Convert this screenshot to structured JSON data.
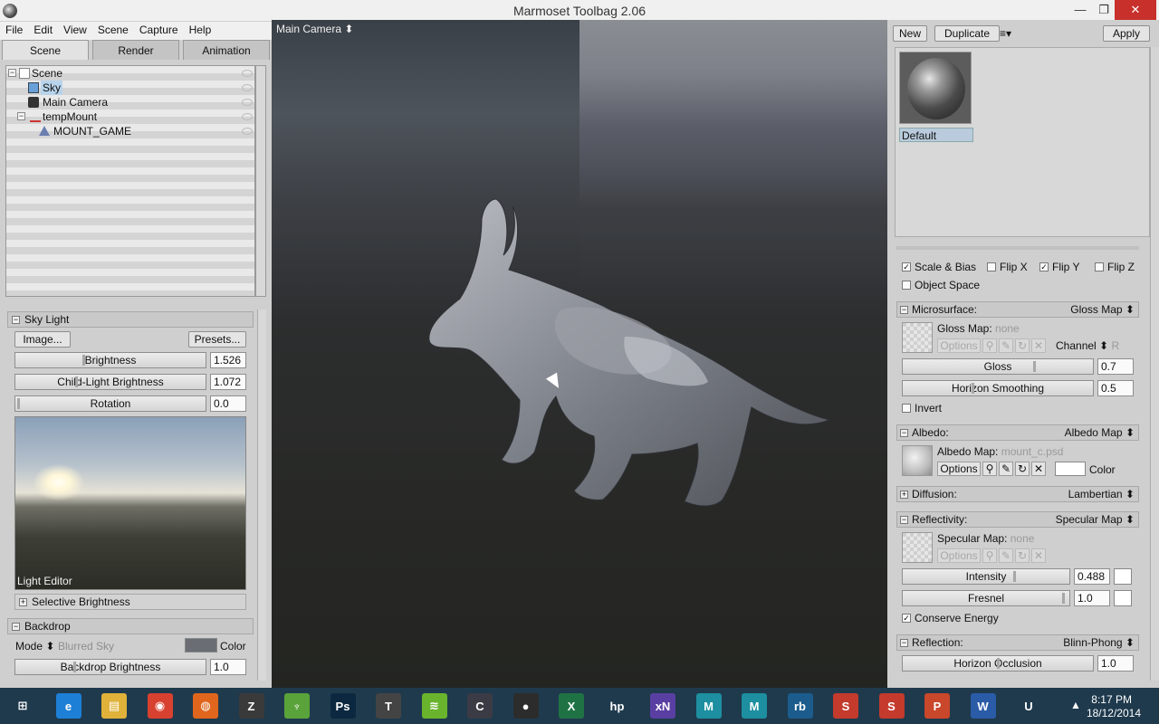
{
  "window": {
    "title": "Marmoset Toolbag 2.06",
    "min": "—",
    "max": "❐",
    "close": "✕"
  },
  "menu": [
    "File",
    "Edit",
    "View",
    "Scene",
    "Capture",
    "Help"
  ],
  "tabs": [
    "Scene",
    "Render",
    "Animation"
  ],
  "tree": [
    {
      "label": "Scene"
    },
    {
      "label": "Sky"
    },
    {
      "label": "Main Camera"
    },
    {
      "label": "tempMount"
    },
    {
      "label": "MOUNT_GAME"
    }
  ],
  "sky_light": {
    "header": "Sky Light",
    "image_btn": "Image...",
    "presets_btn": "Presets...",
    "brightness_label": "Brightness",
    "brightness_value": "1.526",
    "child_label": "Child-Light Brightness",
    "child_value": "1.072",
    "rotation_label": "Rotation",
    "rotation_value": "0.0",
    "preview_label": "Light Editor",
    "selective": "Selective Brightness"
  },
  "backdrop": {
    "header": "Backdrop",
    "mode_label": "Mode",
    "mode_value": "Blurred Sky",
    "color_label": "Color",
    "brightness_label": "Backdrop Brightness",
    "brightness_value": "1.0"
  },
  "viewport": {
    "camera": "Main Camera ⬍"
  },
  "materials": {
    "new_btn": "New",
    "duplicate_btn": "Duplicate",
    "menu_glyph": "≡▾",
    "apply_btn": "Apply",
    "selected": "Default"
  },
  "normal_opts": {
    "scale_bias": "Scale & Bias",
    "flip_x": "Flip X",
    "flip_y": "Flip Y",
    "flip_z": "Flip Z",
    "object_space": "Object Space"
  },
  "microsurface": {
    "header": "Microsurface:",
    "mode": "Gloss Map ⬍",
    "map_label": "Gloss Map:",
    "map_value": "none",
    "options": "Options",
    "channel_label": "Channel ⬍",
    "channel_value": "R",
    "gloss_label": "Gloss",
    "gloss_value": "0.7",
    "horizon_label": "Horizon Smoothing",
    "horizon_value": "0.5",
    "invert": "Invert"
  },
  "albedo": {
    "header": "Albedo:",
    "mode": "Albedo Map ⬍",
    "map_label": "Albedo Map:",
    "map_value": "mount_c.psd",
    "options": "Options",
    "color_label": "Color"
  },
  "diffusion": {
    "header": "Diffusion:",
    "mode": "Lambertian ⬍"
  },
  "reflectivity": {
    "header": "Reflectivity:",
    "mode": "Specular Map ⬍",
    "map_label": "Specular Map:",
    "map_value": "none",
    "options": "Options",
    "intensity_label": "Intensity",
    "intensity_value": "0.488",
    "fresnel_label": "Fresnel",
    "fresnel_value": "1.0",
    "conserve": "Conserve Energy"
  },
  "reflection": {
    "header": "Reflection:",
    "mode": "Blinn-Phong ⬍",
    "horizon_label": "Horizon Occlusion",
    "horizon_value": "1.0"
  },
  "taskbar": {
    "time": "8:17 PM",
    "date": "18/12/2014",
    "tray_arrow": "▲",
    "apps": [
      {
        "name": "start",
        "glyph": "⊞",
        "color": "#1f3a4d"
      },
      {
        "name": "ie",
        "glyph": "e",
        "color": "#1e7fd6"
      },
      {
        "name": "explorer",
        "glyph": "▤",
        "color": "#e0b23a"
      },
      {
        "name": "chrome",
        "glyph": "◉",
        "color": "#d8412f"
      },
      {
        "name": "firefox",
        "glyph": "◍",
        "color": "#e0661d"
      },
      {
        "name": "zbrush",
        "glyph": "Z",
        "color": "#3a3a3a"
      },
      {
        "name": "xnormal",
        "glyph": "♆",
        "color": "#5aa33a"
      },
      {
        "name": "photoshop",
        "glyph": "Ps",
        "color": "#0b2840"
      },
      {
        "name": "t-app",
        "glyph": "T",
        "color": "#444444"
      },
      {
        "name": "spotify",
        "glyph": "≋",
        "color": "#6ab42d"
      },
      {
        "name": "c-app",
        "glyph": "C",
        "color": "#3b3b45"
      },
      {
        "name": "marmoset",
        "glyph": "●",
        "color": "#2c2c2c"
      },
      {
        "name": "excel",
        "glyph": "X",
        "color": "#1f7244"
      },
      {
        "name": "hp",
        "glyph": "hp",
        "color": "#1f3a4d"
      },
      {
        "name": "xn",
        "glyph": "xN",
        "color": "#5a3fa3"
      },
      {
        "name": "maya-lt",
        "glyph": "M",
        "color": "#1d8fa0"
      },
      {
        "name": "maya",
        "glyph": "M",
        "color": "#1d8fa0"
      },
      {
        "name": "rb",
        "glyph": "rb",
        "color": "#1b5c8c"
      },
      {
        "name": "substance",
        "glyph": "S",
        "color": "#c43a2c"
      },
      {
        "name": "substance2",
        "glyph": "S",
        "color": "#c43a2c"
      },
      {
        "name": "powerpoint",
        "glyph": "P",
        "color": "#c9472a"
      },
      {
        "name": "word",
        "glyph": "W",
        "color": "#2a5ba7"
      },
      {
        "name": "unreal",
        "glyph": "U",
        "color": "#1f3a4d"
      }
    ]
  }
}
